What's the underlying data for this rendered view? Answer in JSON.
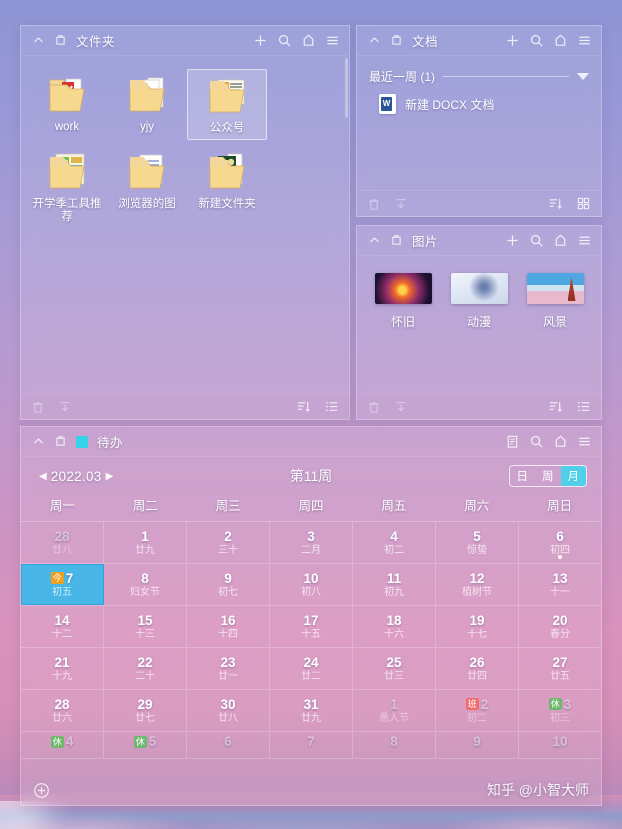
{
  "folders_panel": {
    "title": "文件夹",
    "icons": {
      "collapse": "chevron-up-icon",
      "pin": "pin-icon",
      "add": "plus-icon",
      "search": "search-icon",
      "shirt": "hanger-icon",
      "menu": "hamburger-menu-icon",
      "trash": "trash-icon",
      "download": "download-icon",
      "sort": "sort-icon",
      "view": "list-view-icon"
    },
    "items": [
      {
        "label": "work",
        "selected": false
      },
      {
        "label": "yjy",
        "selected": false
      },
      {
        "label": "公众号",
        "selected": true
      },
      {
        "label": "开学季工具推荐",
        "selected": false
      },
      {
        "label": "浏览器的图",
        "selected": false
      },
      {
        "label": "新建文件夹",
        "selected": false
      }
    ]
  },
  "docs_panel": {
    "title": "文档",
    "group_label": "最近一周 (1)",
    "items": [
      {
        "label": "新建 DOCX 文档",
        "type": "docx"
      }
    ]
  },
  "pics_panel": {
    "title": "图片",
    "items": [
      {
        "label": "怀旧",
        "thumb": "t-huaijiu"
      },
      {
        "label": "动漫",
        "thumb": "t-dongman"
      },
      {
        "label": "风景",
        "thumb": "t-fengjing"
      }
    ]
  },
  "todo_panel": {
    "title": "待办",
    "accent_color": "#35d2e8",
    "calendar": {
      "year_month": "2022.03",
      "week_label": "第11周",
      "prev_arrow": "◀",
      "next_arrow": "▶",
      "view_modes": [
        {
          "label": "日",
          "selected": false
        },
        {
          "label": "周",
          "selected": false
        },
        {
          "label": "月",
          "selected": true
        }
      ],
      "weekday_headers": [
        "周一",
        "周二",
        "周三",
        "周四",
        "周五",
        "周六",
        "周日"
      ],
      "weeks": [
        [
          {
            "num": "28",
            "sub": "廿八",
            "out": true
          },
          {
            "num": "1",
            "sub": "廿九",
            "out": false
          },
          {
            "num": "2",
            "sub": "三十",
            "out": false
          },
          {
            "num": "3",
            "sub": "二月",
            "out": false
          },
          {
            "num": "4",
            "sub": "初二",
            "out": false
          },
          {
            "num": "5",
            "sub": "惊蛰",
            "out": false
          },
          {
            "num": "6",
            "sub": "初四",
            "out": false,
            "dot": true
          }
        ],
        [
          {
            "num": "7",
            "sub": "初五",
            "out": false,
            "today": true,
            "badge": "今",
            "badge_type": "jin"
          },
          {
            "num": "8",
            "sub": "妇女节",
            "out": false
          },
          {
            "num": "9",
            "sub": "初七",
            "out": false
          },
          {
            "num": "10",
            "sub": "初八",
            "out": false
          },
          {
            "num": "11",
            "sub": "初九",
            "out": false
          },
          {
            "num": "12",
            "sub": "植树节",
            "out": false
          },
          {
            "num": "13",
            "sub": "十一",
            "out": false
          }
        ],
        [
          {
            "num": "14",
            "sub": "十二",
            "out": false
          },
          {
            "num": "15",
            "sub": "十三",
            "out": false
          },
          {
            "num": "16",
            "sub": "十四",
            "out": false
          },
          {
            "num": "17",
            "sub": "十五",
            "out": false
          },
          {
            "num": "18",
            "sub": "十六",
            "out": false
          },
          {
            "num": "19",
            "sub": "十七",
            "out": false
          },
          {
            "num": "20",
            "sub": "春分",
            "out": false
          }
        ],
        [
          {
            "num": "21",
            "sub": "十九",
            "out": false
          },
          {
            "num": "22",
            "sub": "二十",
            "out": false
          },
          {
            "num": "23",
            "sub": "廿一",
            "out": false
          },
          {
            "num": "24",
            "sub": "廿二",
            "out": false
          },
          {
            "num": "25",
            "sub": "廿三",
            "out": false
          },
          {
            "num": "26",
            "sub": "廿四",
            "out": false
          },
          {
            "num": "27",
            "sub": "廿五",
            "out": false
          }
        ],
        [
          {
            "num": "28",
            "sub": "廿六",
            "out": false
          },
          {
            "num": "29",
            "sub": "廿七",
            "out": false
          },
          {
            "num": "30",
            "sub": "廿八",
            "out": false
          },
          {
            "num": "31",
            "sub": "廿九",
            "out": false
          },
          {
            "num": "1",
            "sub": "愚人节",
            "out": true
          },
          {
            "num": "2",
            "sub": "初二",
            "out": true,
            "badge": "班",
            "badge_type": "ban"
          },
          {
            "num": "3",
            "sub": "初三",
            "out": true,
            "badge": "休",
            "badge_type": "xiu"
          }
        ],
        [
          {
            "num": "4",
            "sub": "",
            "out": true,
            "badge": "休",
            "badge_type": "xiu"
          },
          {
            "num": "5",
            "sub": "",
            "out": true,
            "badge": "休",
            "badge_type": "xiu"
          },
          {
            "num": "6",
            "sub": "",
            "out": true
          },
          {
            "num": "7",
            "sub": "",
            "out": true
          },
          {
            "num": "8",
            "sub": "",
            "out": true
          },
          {
            "num": "9",
            "sub": "",
            "out": true
          },
          {
            "num": "10",
            "sub": "",
            "out": true
          }
        ]
      ]
    },
    "add_button": "plus-circle-icon",
    "watermark": "知乎 @小智大师"
  }
}
